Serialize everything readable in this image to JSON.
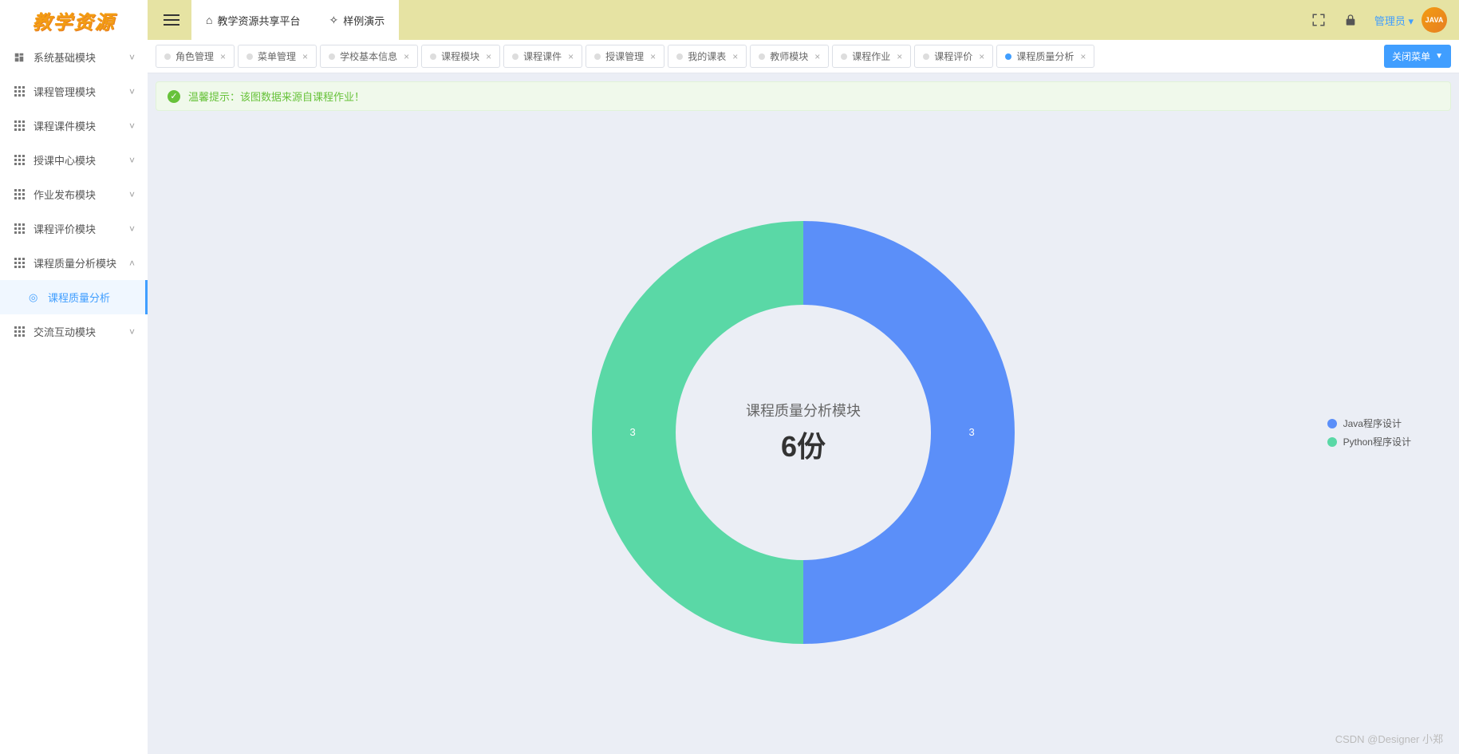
{
  "logo": "教学资源",
  "header": {
    "platform_label": "教学资源共享平台",
    "demo_label": "样例演示",
    "admin_label": "管理员",
    "avatar_text": "JAVA"
  },
  "sidebar": {
    "items": [
      {
        "label": "系统基础模块",
        "icon": "dashboard-icon",
        "expanded": false
      },
      {
        "label": "课程管理模块",
        "icon": "grid-icon",
        "expanded": false
      },
      {
        "label": "课程课件模块",
        "icon": "grid-icon",
        "expanded": false
      },
      {
        "label": "授课中心模块",
        "icon": "grid-icon",
        "expanded": false
      },
      {
        "label": "作业发布模块",
        "icon": "grid-icon",
        "expanded": false
      },
      {
        "label": "课程评价模块",
        "icon": "grid-icon",
        "expanded": false
      },
      {
        "label": "课程质量分析模块",
        "icon": "grid-icon",
        "expanded": true
      },
      {
        "label": "交流互动模块",
        "icon": "grid-icon",
        "expanded": false
      }
    ],
    "active_sub": "课程质量分析"
  },
  "tabs": {
    "items": [
      {
        "label": "角色管理",
        "active": false
      },
      {
        "label": "菜单管理",
        "active": false
      },
      {
        "label": "学校基本信息",
        "active": false
      },
      {
        "label": "课程模块",
        "active": false
      },
      {
        "label": "课程课件",
        "active": false
      },
      {
        "label": "授课管理",
        "active": false
      },
      {
        "label": "我的课表",
        "active": false
      },
      {
        "label": "教师模块",
        "active": false
      },
      {
        "label": "课程作业",
        "active": false
      },
      {
        "label": "课程评价",
        "active": false
      },
      {
        "label": "课程质量分析",
        "active": true
      }
    ],
    "close_menu_label": "关闭菜单"
  },
  "hint": {
    "text": "温馨提示：该图数据来源自课程作业！"
  },
  "chart_data": {
    "type": "pie",
    "title": "课程质量分析模块",
    "total_label": "6份",
    "series": [
      {
        "name": "Java程序设计",
        "value": 3,
        "color": "#5b8ff9"
      },
      {
        "name": "Python程序设计",
        "value": 3,
        "color": "#5ad8a6"
      }
    ]
  },
  "watermark": "CSDN @Designer 小郑"
}
